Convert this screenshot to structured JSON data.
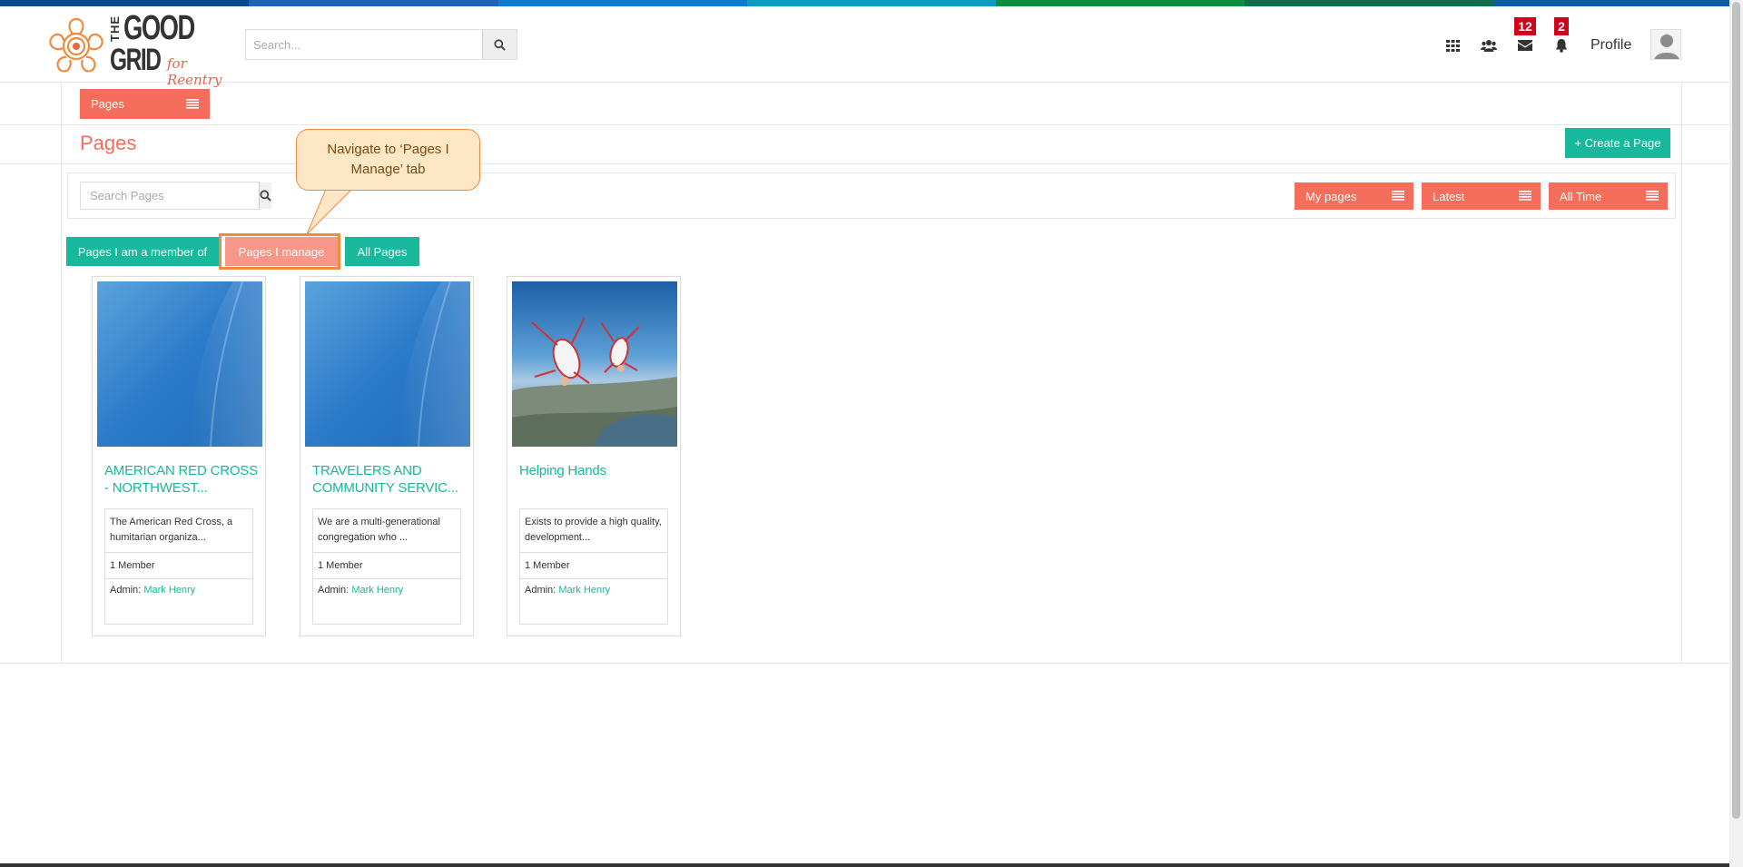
{
  "colors": {
    "coral": "#f46e5b",
    "teal": "#17b89b",
    "strip": [
      "#094a8f",
      "#1f63b8",
      "#0a7fd2",
      "#0a9dc0",
      "#0d8f3d",
      "#0b6e4b",
      "#0d5aa8"
    ]
  },
  "header": {
    "logo": {
      "the": "THE",
      "good": "GOOD",
      "grid": "GRID",
      "tagline": "for Reentry"
    },
    "search": {
      "placeholder": "Search...",
      "icon": "search-icon"
    },
    "icons": [
      {
        "name": "apps-grid-icon"
      },
      {
        "name": "friends-icon"
      },
      {
        "name": "messages-icon",
        "badge": "12"
      },
      {
        "name": "notifications-icon",
        "badge": "2"
      }
    ],
    "profile_label": "Profile",
    "avatar_icon": "user-avatar-icon"
  },
  "pages_dropdown": {
    "label": "Pages",
    "icon": "menu-lines-icon"
  },
  "main": {
    "title": "Pages",
    "create_button": "+ Create a Page",
    "search_placeholder": "Search Pages",
    "filters": [
      {
        "label": "My pages"
      },
      {
        "label": "Latest"
      },
      {
        "label": "All Time"
      }
    ],
    "tabs": [
      {
        "label": "Pages I am a member of"
      },
      {
        "label": "Pages I manage",
        "active": true
      },
      {
        "label": "All Pages"
      }
    ],
    "callout": "Navigate to ‘Pages I Manage’ tab"
  },
  "cards": [
    {
      "name": "AMERICAN RED CROSS - NORTHWEST...",
      "description": "The American Red Cross, a humitarian organiza...",
      "members": "1 Member",
      "admin_label": "Admin:",
      "admin_name": "Mark Henry",
      "image": "blue-gradient"
    },
    {
      "name": "TRAVELERS AND COMMUNITY SERVIC...",
      "description": "We are a multi-generational congregation who ...",
      "members": "1 Member",
      "admin_label": "Admin:",
      "admin_name": "Mark Henry",
      "image": "blue-gradient"
    },
    {
      "name": "Helping Hands",
      "description": "Exists to provide a high quality, development...",
      "members": "1 Member",
      "admin_label": "Admin:",
      "admin_name": "Mark Henry",
      "image": "skydivers-photo"
    }
  ]
}
